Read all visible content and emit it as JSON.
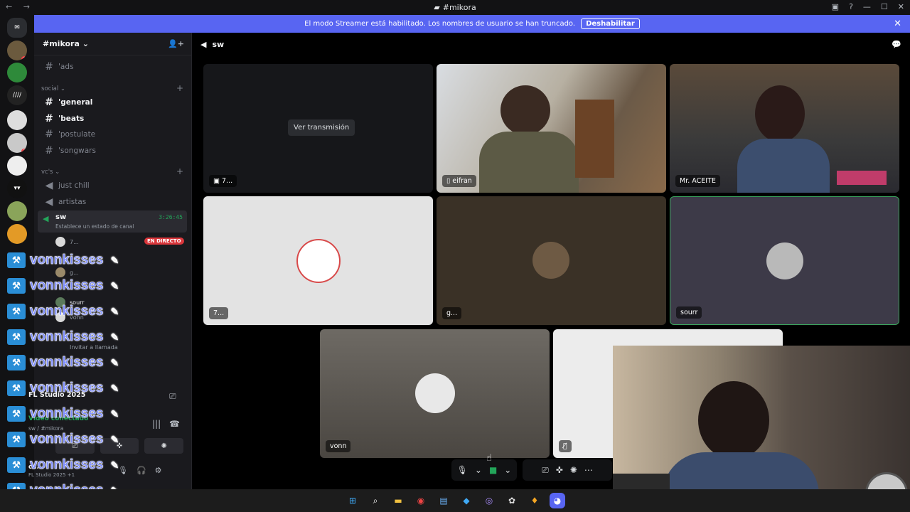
{
  "window": {
    "title": "#mikora",
    "nav_back": "←",
    "nav_fwd": "→"
  },
  "banner": {
    "text": "El modo Streamer está habilitado. Los nombres de usuario se han truncado.",
    "button": "Deshabilitar"
  },
  "server": {
    "name": "#mikora"
  },
  "channels_top": [
    {
      "label": "'ads"
    }
  ],
  "categories": {
    "social": "social",
    "vcs": "vc's"
  },
  "social_channels": [
    {
      "label": "'general"
    },
    {
      "label": "'beats"
    },
    {
      "label": "'postulate"
    },
    {
      "label": "'songwars"
    }
  ],
  "voice_channels": [
    {
      "label": "just chill"
    },
    {
      "label": "artistas"
    }
  ],
  "sw_channel": {
    "name": "sw",
    "timer": "3:26:45",
    "status": "Establece un estado de canal"
  },
  "live_badge": "EN DIRECTO",
  "members": [
    {
      "name": "7..."
    },
    {
      "name": "g..."
    },
    {
      "name": "sourr"
    },
    {
      "name": "vonn"
    }
  ],
  "invite": "Invitar a llamada",
  "overlay_name": "vonnkisses",
  "activity": {
    "name": "FL Studio 2025"
  },
  "voice_status": {
    "label": "Vídeo conectado",
    "channel": "sw / #mikora"
  },
  "user": {
    "name": "c...",
    "activity": "FL Studio 2025 +1"
  },
  "call": {
    "header": "sw",
    "watch_button": "Ver transmisión",
    "tiles": [
      {
        "label": "7..."
      },
      {
        "label": "eifran"
      },
      {
        "label": "Mr. ACEITE"
      },
      {
        "label": "7..."
      },
      {
        "label": "g..."
      },
      {
        "label": "sourr"
      },
      {
        "label": "vonn"
      },
      {
        "label": ""
      }
    ]
  },
  "icons": {
    "mic": "mic-icon",
    "camera": "camera-icon",
    "screen": "screen-share-icon",
    "activity": "activity-icon",
    "soundboard": "soundboard-icon",
    "more": "more-icon"
  }
}
